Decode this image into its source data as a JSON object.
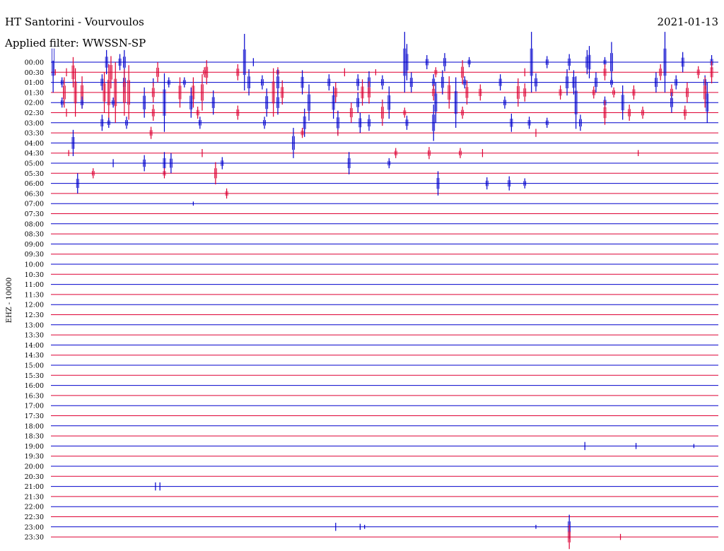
{
  "header": {
    "station": "HT Santorini - Vourvoulos",
    "filter": "Applied filter: WWSSN-SP",
    "date": "2021-01-13"
  },
  "chart_data": {
    "type": "line",
    "title": "HT Santorini - Vourvoulos",
    "subtitle": "Applied filter: WWSSN-SP",
    "date": "2021-01-13",
    "ylabel": "EHZ - 10000",
    "xlabel": "",
    "grid": false,
    "colors": {
      "even_row": "#0000cc",
      "odd_row": "#dd0033",
      "text": "#000000"
    },
    "x_range_minutes": [
      0,
      30
    ],
    "row_labels": [
      "00:00",
      "00:30",
      "01:00",
      "01:30",
      "02:00",
      "02:30",
      "03:00",
      "03:30",
      "04:00",
      "04:30",
      "05:00",
      "05:30",
      "06:00",
      "06:30",
      "07:00",
      "07:30",
      "08:00",
      "08:30",
      "09:00",
      "09:30",
      "10:00",
      "10:30",
      "11:00",
      "11:30",
      "12:00",
      "12:30",
      "13:00",
      "13:30",
      "14:00",
      "14:30",
      "15:00",
      "15:30",
      "16:00",
      "16:30",
      "17:00",
      "17:30",
      "18:00",
      "18:30",
      "19:00",
      "19:30",
      "20:00",
      "20:30",
      "21:00",
      "21:30",
      "22:00",
      "22:30",
      "23:00",
      "23:30"
    ],
    "events": [
      [
        0,
        [
          [
            0.1,
            -3.0
          ],
          [
            2.5,
            1.2
          ],
          [
            3.1,
            0.8
          ],
          [
            3.3,
            1.2
          ],
          [
            8.7,
            2.8
          ],
          [
            9.1,
            0.4
          ],
          [
            15.9,
            3.0
          ],
          [
            16.0,
            1.8
          ],
          [
            16.9,
            0.7
          ],
          [
            17.7,
            0.9
          ],
          [
            18.8,
            0.5
          ],
          [
            21.6,
            3.0
          ],
          [
            22.3,
            0.6
          ],
          [
            23.3,
            0.8
          ],
          [
            24.1,
            1.2
          ],
          [
            24.2,
            1.6
          ],
          [
            24.9,
            0.5
          ],
          [
            25.2,
            2.0
          ],
          [
            27.6,
            3.0
          ],
          [
            28.4,
            1.0
          ],
          [
            29.7,
            0.7
          ]
        ]
      ],
      [
        1,
        [
          [
            0.2,
            0.3
          ],
          [
            0.7,
            0.4
          ],
          [
            1.0,
            1.5
          ],
          [
            2.7,
            1.6
          ],
          [
            4.8,
            1.0
          ],
          [
            6.9,
            0.5
          ],
          [
            7.0,
            1.2
          ],
          [
            8.4,
            0.8
          ],
          [
            10.2,
            0.5
          ],
          [
            13.2,
            0.4
          ],
          [
            14.6,
            0.3
          ],
          [
            17.3,
            0.5
          ],
          [
            18.5,
            1.2
          ],
          [
            21.3,
            0.4
          ],
          [
            24.9,
            0.8
          ],
          [
            27.4,
            0.8
          ],
          [
            29.1,
            0.6
          ],
          [
            29.7,
            1.1
          ]
        ]
      ],
      [
        2,
        [
          [
            0.5,
            0.5
          ],
          [
            2.3,
            0.8
          ],
          [
            3.3,
            1.0
          ],
          [
            4.6,
            0.4
          ],
          [
            5.3,
            0.5
          ],
          [
            6.0,
            0.5
          ],
          [
            8.9,
            1.3
          ],
          [
            9.5,
            0.7
          ],
          [
            10.2,
            1.3
          ],
          [
            11.3,
            1.2
          ],
          [
            12.5,
            0.8
          ],
          [
            13.8,
            0.8
          ],
          [
            14.3,
            1.1
          ],
          [
            14.9,
            0.7
          ],
          [
            16.2,
            1.0
          ],
          [
            17.2,
            0.8
          ],
          [
            17.6,
            1.2
          ],
          [
            18.6,
            0.6
          ],
          [
            20.2,
            0.8
          ],
          [
            21.8,
            0.9
          ],
          [
            23.2,
            1.3
          ],
          [
            23.5,
            1.2
          ],
          [
            24.5,
            1.0
          ],
          [
            25.2,
            0.5
          ],
          [
            27.2,
            1.0
          ],
          [
            28.1,
            0.7
          ],
          [
            29.4,
            0.7
          ]
        ]
      ],
      [
        3,
        [
          [
            0.6,
            1.5
          ],
          [
            1.1,
            2.4
          ],
          [
            1.4,
            1.6
          ],
          [
            2.4,
            2.0
          ],
          [
            2.6,
            2.8
          ],
          [
            2.9,
            3.0
          ],
          [
            3.3,
            2.3
          ],
          [
            3.5,
            2.7
          ],
          [
            4.6,
            1.0
          ],
          [
            5.8,
            1.5
          ],
          [
            6.4,
            1.5
          ],
          [
            6.8,
            1.8
          ],
          [
            10.0,
            2.4
          ],
          [
            10.4,
            1.2
          ],
          [
            12.8,
            1.0
          ],
          [
            14.0,
            1.3
          ],
          [
            14.3,
            1.1
          ],
          [
            17.2,
            0.8
          ],
          [
            17.9,
            1.6
          ],
          [
            18.7,
            1.2
          ],
          [
            19.3,
            0.8
          ],
          [
            21.0,
            1.4
          ],
          [
            21.3,
            0.9
          ],
          [
            22.9,
            0.7
          ],
          [
            24.4,
            0.6
          ],
          [
            25.3,
            0.5
          ],
          [
            26.2,
            0.7
          ],
          [
            27.9,
            0.8
          ],
          [
            28.6,
            1.0
          ],
          [
            29.4,
            1.5
          ]
        ]
      ],
      [
        4,
        [
          [
            0.5,
            0.5
          ],
          [
            1.4,
            0.6
          ],
          [
            2.8,
            0.5
          ],
          [
            4.2,
            1.5
          ],
          [
            5.1,
            2.9
          ],
          [
            6.3,
            1.5
          ],
          [
            7.3,
            1.2
          ],
          [
            9.7,
            1.4
          ],
          [
            10.2,
            1.2
          ],
          [
            11.6,
            1.8
          ],
          [
            12.7,
            1.6
          ],
          [
            13.8,
            1.0
          ],
          [
            15.2,
            1.6
          ],
          [
            17.3,
            2.0
          ],
          [
            18.2,
            2.5
          ],
          [
            20.4,
            0.6
          ],
          [
            23.6,
            2.6
          ],
          [
            24.9,
            0.6
          ],
          [
            25.7,
            1.7
          ],
          [
            27.9,
            1.0
          ],
          [
            29.5,
            2.0
          ]
        ]
      ],
      [
        5,
        [
          [
            0.7,
            0.4
          ],
          [
            4.6,
            0.8
          ],
          [
            6.6,
            0.6
          ],
          [
            8.4,
            0.7
          ],
          [
            13.5,
            1.0
          ],
          [
            14.9,
            1.3
          ],
          [
            15.9,
            0.5
          ],
          [
            18.5,
            0.6
          ],
          [
            24.9,
            1.2
          ],
          [
            26.0,
            0.8
          ],
          [
            26.6,
            0.6
          ],
          [
            28.5,
            0.7
          ]
        ]
      ],
      [
        6,
        [
          [
            2.3,
            0.8
          ],
          [
            2.6,
            0.5
          ],
          [
            3.4,
            0.6
          ],
          [
            6.7,
            0.6
          ],
          [
            9.6,
            0.6
          ],
          [
            11.4,
            1.4
          ],
          [
            12.9,
            1.2
          ],
          [
            13.9,
            1.0
          ],
          [
            14.3,
            0.8
          ],
          [
            16.0,
            0.7
          ],
          [
            17.2,
            1.8
          ],
          [
            20.7,
            0.9
          ],
          [
            21.5,
            0.6
          ],
          [
            22.3,
            0.5
          ],
          [
            23.8,
            0.8
          ]
        ]
      ],
      [
        7,
        [
          [
            4.5,
            0.6
          ],
          [
            11.3,
            0.5
          ],
          [
            12.9,
            0.3
          ],
          [
            21.8,
            0.4
          ]
        ]
      ],
      [
        8,
        [
          [
            1.0,
            1.3
          ],
          [
            10.9,
            1.5
          ]
        ]
      ],
      [
        9,
        [
          [
            0.8,
            0.3
          ],
          [
            6.8,
            0.4
          ],
          [
            15.5,
            0.5
          ],
          [
            17.0,
            0.6
          ],
          [
            18.4,
            0.5
          ],
          [
            19.4,
            0.4
          ],
          [
            26.4,
            0.3
          ]
        ]
      ],
      [
        10,
        [
          [
            2.8,
            0.4
          ],
          [
            4.2,
            0.8
          ],
          [
            5.1,
            1.1
          ],
          [
            5.4,
            1.0
          ],
          [
            7.7,
            0.6
          ],
          [
            13.4,
            1.1
          ],
          [
            15.2,
            0.5
          ]
        ]
      ],
      [
        11,
        [
          [
            1.9,
            0.5
          ],
          [
            5.1,
            0.5
          ],
          [
            7.4,
            1.1
          ]
        ]
      ],
      [
        12,
        [
          [
            1.2,
            1.0
          ],
          [
            17.4,
            1.2
          ],
          [
            19.6,
            0.6
          ],
          [
            20.6,
            0.7
          ],
          [
            21.3,
            0.5
          ]
        ]
      ],
      [
        13,
        [
          [
            7.9,
            0.5
          ]
        ]
      ],
      [
        14,
        [
          [
            6.4,
            0.2
          ]
        ]
      ],
      [
        38,
        [
          [
            24.0,
            0.4
          ],
          [
            26.3,
            0.3
          ],
          [
            28.9,
            0.2
          ]
        ]
      ],
      [
        42,
        [
          [
            4.7,
            0.4
          ],
          [
            4.9,
            0.4
          ]
        ]
      ],
      [
        46,
        [
          [
            12.8,
            0.4
          ],
          [
            13.9,
            0.3
          ],
          [
            14.1,
            0.2
          ],
          [
            21.8,
            0.2
          ],
          [
            23.3,
            1.2
          ]
        ]
      ],
      [
        47,
        [
          [
            23.3,
            1.2
          ],
          [
            25.6,
            0.3
          ]
        ]
      ]
    ]
  }
}
